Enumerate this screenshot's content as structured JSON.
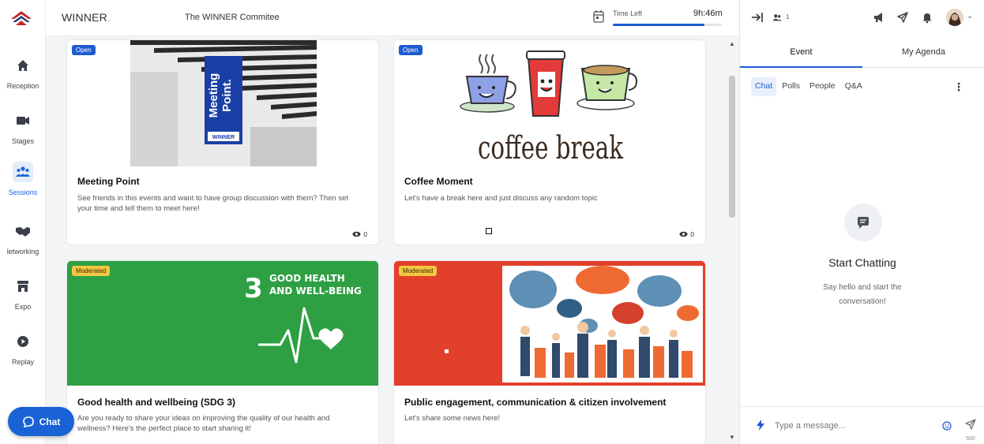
{
  "header": {
    "brand": "WINNER",
    "brand_dot": ".",
    "committee": "The WINNER Commitee",
    "time_left_label": "Time Left",
    "time_left_value": "9h:46m",
    "time_progress": 0.84
  },
  "sidebar": {
    "items": [
      {
        "label": "Reception",
        "icon": "home-icon"
      },
      {
        "label": "Stages",
        "icon": "video-camera-icon"
      },
      {
        "label": "Sessions",
        "icon": "group-icon",
        "active": true
      },
      {
        "label": "letworking",
        "icon": "handshake-icon"
      },
      {
        "label": "Expo",
        "icon": "store-icon"
      },
      {
        "label": "Replay",
        "icon": "play-icon"
      }
    ]
  },
  "sessions": [
    {
      "badge": "Open",
      "title": "Meeting Point",
      "desc": "See friends in this events and want to have group discussion with them? Then set your time and tell them to meet here!",
      "views": "0",
      "sign_lines": [
        "Meeting",
        "Point."
      ],
      "sign_brand": "WINNER"
    },
    {
      "badge": "Open",
      "title": "Coffee Moment",
      "desc": "Let's have a break here and just discuss any random topic",
      "views": "0",
      "image_text": "coffee break"
    },
    {
      "badge": "Moderated",
      "title": "Good health and wellbeing (SDG 3)",
      "desc": "Are you ready to share your ideas on improving the quality of our health and wellness? Here's the perfect place to start sharing it!",
      "sdg_number": "3",
      "sdg_line1": "GOOD HEALTH",
      "sdg_line2": "AND WELL-BEING",
      "color": "#2ea043"
    },
    {
      "badge": "Moderated",
      "title": "Public engagement, communication & citizen involvement",
      "desc": "Let's share some news here!",
      "color": "#e2402b"
    }
  ],
  "panel": {
    "attendees": "1",
    "tabs": [
      "Event",
      "My Agenda"
    ],
    "subtabs": [
      "Chat",
      "Polls",
      "People",
      "Q&A"
    ],
    "empty_title": "Start Chatting",
    "empty_sub": "Say hello and start the conversation!",
    "composer_placeholder": "Type a message...",
    "char_limit": "500"
  },
  "fab": {
    "label": "Chat"
  },
  "colors": {
    "accent": "#1e5bd0",
    "open_badge": "#1e5bd0",
    "moderated_badge": "#f4c842"
  }
}
